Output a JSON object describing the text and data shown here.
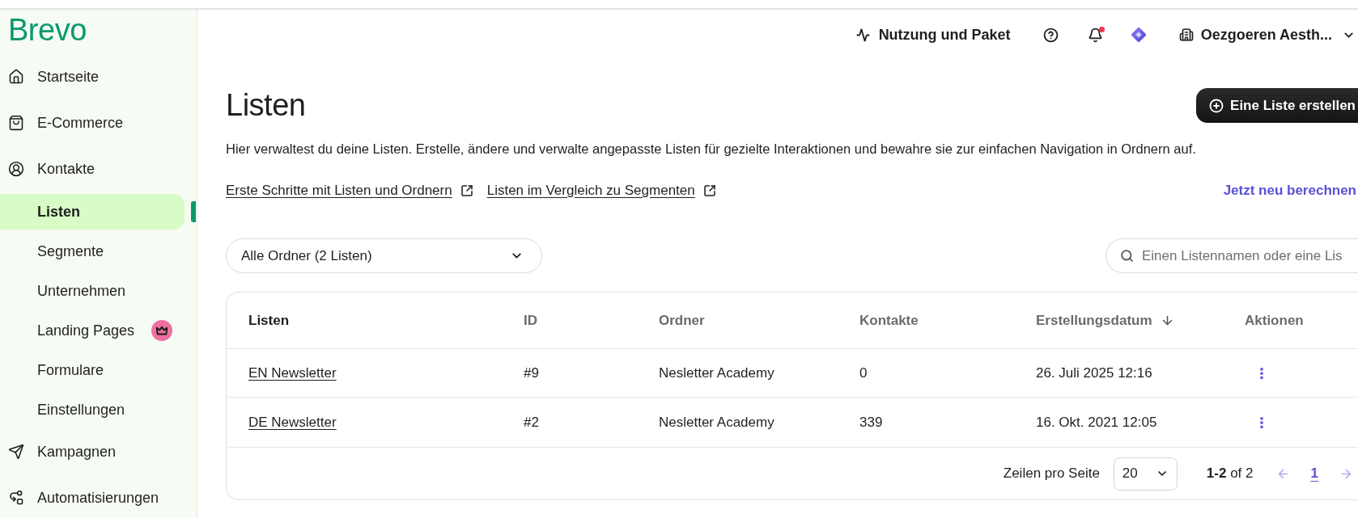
{
  "top_bar": {
    "usage_link": "Nutzung und Paket",
    "notifications": {
      "unread": true
    },
    "account": {
      "name": "Oezgoeren Aesth..."
    }
  },
  "sidebar": {
    "logo": "Brevo",
    "items": [
      {
        "label": "Startseite",
        "selected": false
      },
      {
        "label": "E-Commerce",
        "selected": false
      },
      {
        "label": "Kontakte",
        "selected": false,
        "children": [
          {
            "label": "Listen",
            "selected": true,
            "premium": false
          },
          {
            "label": "Segmente",
            "selected": false,
            "premium": false
          },
          {
            "label": "Unternehmen",
            "selected": false,
            "premium": false
          },
          {
            "label": "Landing Pages",
            "selected": false,
            "premium": true
          },
          {
            "label": "Formulare",
            "selected": false,
            "premium": false
          },
          {
            "label": "Einstellungen",
            "selected": false,
            "premium": false
          }
        ]
      },
      {
        "label": "Kampagnen",
        "selected": false
      },
      {
        "label": "Automatisierungen",
        "selected": false
      }
    ]
  },
  "page": {
    "title": "Listen",
    "create_button": "Eine Liste erstellen",
    "description": "Hier verwaltest du deine Listen. Erstelle, ändere und verwalte angepasste Listen für gezielte Interaktionen und bewahre sie zur einfachen Navigation in Ordnern auf.",
    "help_links": [
      {
        "label": "Erste Schritte mit Listen und Ordnern"
      },
      {
        "label": "Listen im Vergleich zu Segmenten"
      }
    ],
    "recalculate_link": "Jetzt neu berechnen",
    "folder_filter": {
      "value": "Alle Ordner (2 Listen)"
    },
    "search": {
      "placeholder": "Einen Listennamen oder eine Lis"
    }
  },
  "table": {
    "columns": [
      {
        "label": "Listen",
        "sorted": false
      },
      {
        "label": "ID",
        "sorted": false
      },
      {
        "label": "Ordner",
        "sorted": false
      },
      {
        "label": "Kontakte",
        "sorted": false
      },
      {
        "label": "Erstellungsdatum",
        "sorted": true
      },
      {
        "label": "Aktionen",
        "sorted": false
      }
    ],
    "rows": [
      {
        "name": "EN Newsletter",
        "id": "#9",
        "folder": "Nesletter Academy",
        "contacts": "0",
        "created": "26. Juli 2025 12:16"
      },
      {
        "name": "DE Newsletter",
        "id": "#2",
        "folder": "Nesletter Academy",
        "contacts": "339",
        "created": "16. Okt. 2021 12:05"
      }
    ]
  },
  "pagination": {
    "rows_label": "Zeilen pro Seite",
    "rows_per_page": "20",
    "summary": "**1-2** of 2",
    "previous": {
      "disabled": true
    },
    "next": {
      "disabled": true
    },
    "pages": [
      {
        "label": "1",
        "selected": true
      }
    ]
  }
}
